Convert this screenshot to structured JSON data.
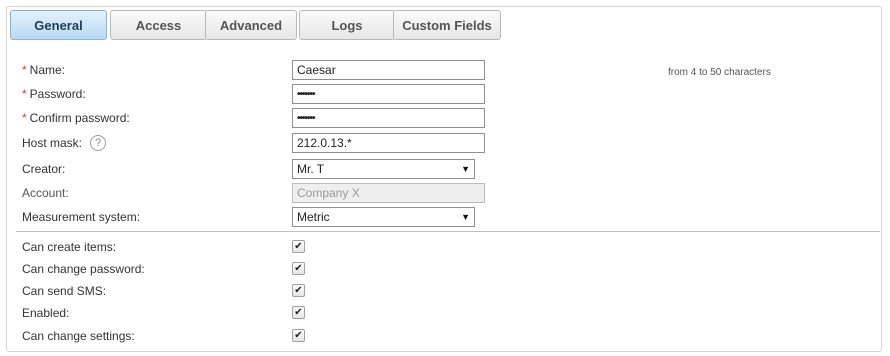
{
  "tabs": {
    "general": "General",
    "access": "Access",
    "advanced": "Advanced",
    "logs": "Logs",
    "custom_fields": "Custom Fields"
  },
  "form": {
    "required_mark": "*",
    "name_label": "Name:",
    "name_value": "Caesar",
    "name_hint": "from 4 to 50 characters",
    "password_label": "Password:",
    "password_value": "•••••••",
    "confirm_label": "Confirm password:",
    "confirm_value": "•••••••",
    "hostmask_label": "Host mask:",
    "help_glyph": "?",
    "hostmask_value": "212.0.13.*",
    "creator_label": "Creator:",
    "creator_value": "Mr. T",
    "account_label": "Account:",
    "account_value": "Company X",
    "measurement_label": "Measurement system:",
    "measurement_value": "Metric",
    "select_caret": "▼"
  },
  "permissions": {
    "check_glyph": "✔",
    "can_create_items_label": "Can create items:",
    "can_create_items_checked": true,
    "can_change_password_label": "Can change password:",
    "can_change_password_checked": true,
    "can_send_sms_label": "Can send SMS:",
    "can_send_sms_checked": true,
    "enabled_label": "Enabled:",
    "enabled_checked": true,
    "can_change_settings_label": "Can change settings:",
    "can_change_settings_checked": true
  },
  "colors": {
    "required": "#d53b3b",
    "active_tab": "#b9d9f2",
    "disabled_field": "#eeeeee"
  },
  "icons": {
    "help": "help-circle-icon",
    "dropdown": "chevron-down-icon",
    "checkmark": "checkmark-icon"
  }
}
